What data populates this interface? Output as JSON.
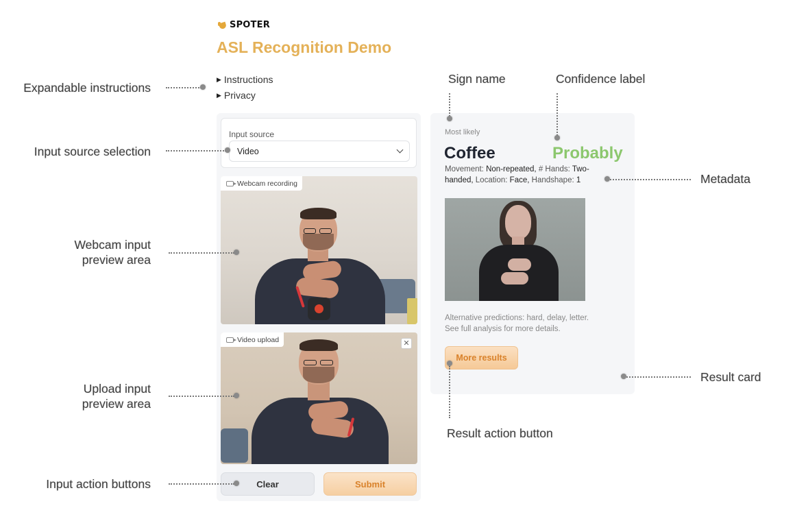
{
  "brand": {
    "name": "SPOTER"
  },
  "app": {
    "title": "ASL Recognition Demo"
  },
  "expanders": [
    {
      "label": "Instructions"
    },
    {
      "label": "Privacy"
    }
  ],
  "input": {
    "source_label": "Input source",
    "source_value": "Video",
    "webcam_tag": "Webcam recording",
    "upload_tag": "Video upload",
    "close_glyph": "✕",
    "clear_label": "Clear",
    "submit_label": "Submit"
  },
  "result": {
    "most_likely_label": "Most likely",
    "sign_name": "Coffee",
    "confidence": "Probably",
    "meta": {
      "movement_label": "Movement:",
      "movement_value": "Non-repeated,",
      "hands_label": "# Hands:",
      "hands_value": "Two-handed,",
      "location_label": "Location:",
      "location_value": "Face,",
      "handshape_label": "Handshape:",
      "handshape_value": "1"
    },
    "alt_line1": "Alternative predictions: hard, delay, letter.",
    "alt_line2": "See full analysis for more details.",
    "more_label": "More results"
  },
  "annotations": {
    "expandable": "Expandable instructions",
    "source": "Input source selection",
    "webcam_line1": "Webcam input",
    "webcam_line2": "preview area",
    "upload_line1": "Upload input",
    "upload_line2": "preview area",
    "actions": "Input action buttons",
    "sign_name": "Sign name",
    "confidence": "Confidence label",
    "metadata": "Metadata",
    "result_card": "Result card",
    "result_action": "Result action button"
  },
  "colors": {
    "title_accent": "#e4b158",
    "confidence_green": "#8cc76e",
    "submit_orange": "#d9822b",
    "record_red": "#d9432e"
  },
  "icons": [
    "spoter-logo-icon",
    "triangle-right-icon",
    "chevron-down-icon",
    "camera-icon",
    "close-icon",
    "record-icon"
  ]
}
